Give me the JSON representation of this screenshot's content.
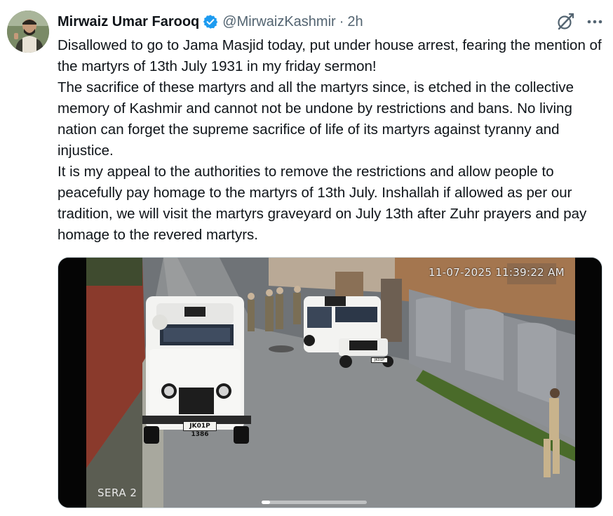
{
  "author": {
    "name": "Mirwaiz Umar Farooq",
    "handle": "@MirwaizKashmir",
    "separator": "·",
    "time": "2h"
  },
  "icons": {
    "verified": "verified-badge-icon",
    "grok": "grok-icon",
    "more": "more-options-icon"
  },
  "tweet": {
    "paragraphs": [
      "Disallowed to go to Jama Masjid today, put under house arrest, fearing the mention of the martyrs of 13th July 1931 in my friday sermon!",
      "The sacrifice of these martyrs and all the martyrs since, is etched in the collective memory of Kashmir and cannot not be undone by restrictions and bans. No living nation can forget the supreme sacrifice of life of its martyrs against tyranny and injustice.",
      "It is my appeal to the authorities to remove the restrictions and allow people to peacefully pay homage to the martyrs of 13th July. Inshallah if allowed as per our tradition, we will visit the martyrs graveyard on July 13th after Zuhr prayers and pay homage to the revered martyrs."
    ]
  },
  "media": {
    "timestamp": "11-07-2025 11:39:22 AM",
    "camera_label": "SERA 2",
    "plate_left": "JK01P 1386",
    "plate_right": "JK01P"
  },
  "colors": {
    "text": "#0f1419",
    "muted": "#536471",
    "verified_blue": "#1d9bf0",
    "border": "#cfd9de"
  }
}
